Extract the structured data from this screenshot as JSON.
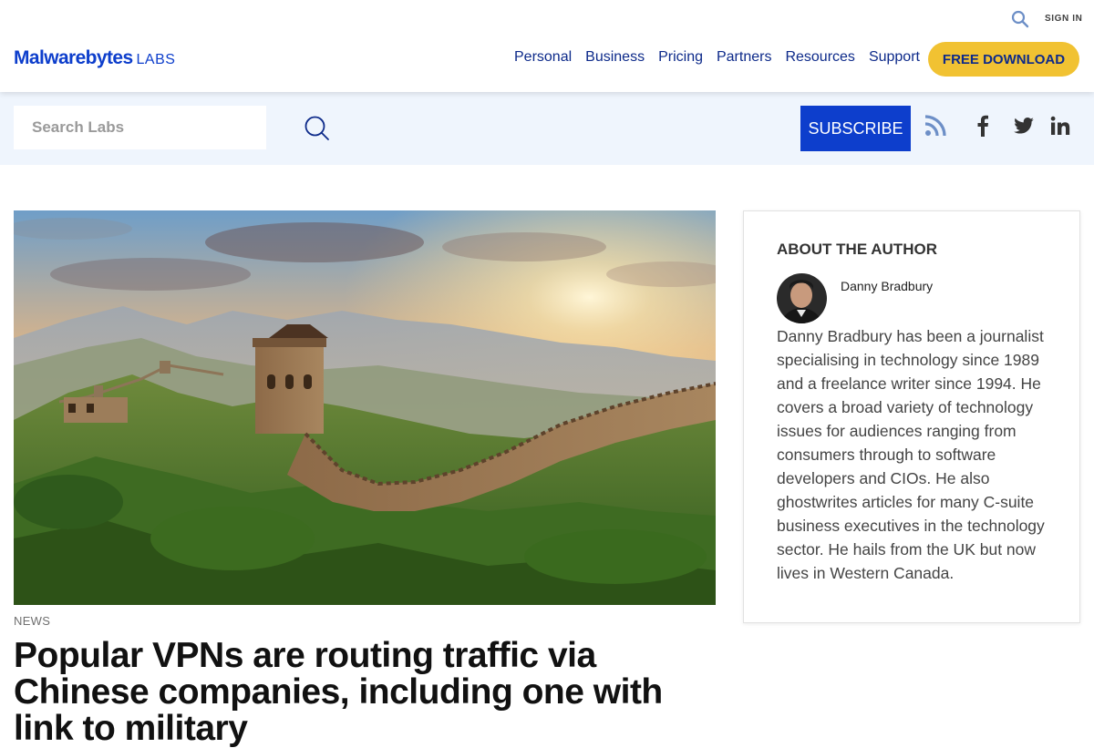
{
  "header": {
    "sign_in": "SIGN IN",
    "logo": {
      "brand": "Malwarebytes",
      "sub": "LABS"
    },
    "nav": [
      "Personal",
      "Business",
      "Pricing",
      "Partners",
      "Resources",
      "Support"
    ],
    "cta": "FREE DOWNLOAD"
  },
  "labs_bar": {
    "search_placeholder": "Search Labs",
    "subscribe": "SUBSCRIBE"
  },
  "article": {
    "category": "NEWS",
    "headline": "Popular VPNs are routing traffic via Chinese companies, including one with link to military"
  },
  "sidebar": {
    "title": "ABOUT THE AUTHOR",
    "author_name": "Danny Bradbury",
    "bio": "Danny Bradbury has been a journalist specialising in technology since 1989 and a freelance writer since 1994. He covers a broad variety of technology issues for audiences ranging from consumers through to software developers and CIOs. He also ghostwrites articles for many C-suite business executives in the technology sector. He hails from the UK but now lives in Western Canada."
  },
  "colors": {
    "brand_blue": "#0d3ecc",
    "nav_blue": "#0d2a8a",
    "cta_yellow": "#f1c232",
    "labs_bar_bg": "#eff5fd"
  }
}
